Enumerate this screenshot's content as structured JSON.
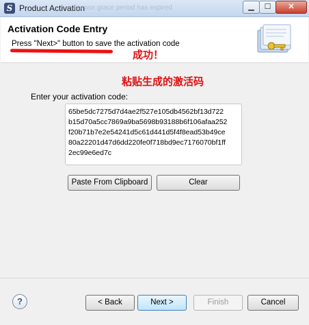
{
  "window": {
    "title": "Product Activation",
    "ghost_title": "license grace period has expired",
    "icon": "app-logo-icon",
    "controls": [
      "minimize-icon",
      "maximize-icon",
      "close-icon"
    ]
  },
  "header": {
    "title": "Activation Code Entry",
    "description": "Press \"Next>\" button to save the activation code",
    "annotation_success": "成功！",
    "art": "folder-key-icon"
  },
  "main": {
    "annotation_paste": "粘贴生成的激活码",
    "code_label": "Enter your activation code:",
    "code_value": "65be5dc7275d7d4ae2f527e105db4562bf13d722\nb15d70a5cc7869a9ba5698b93188b6f106afaa252\nf20b71b7e2e54241d5c61d441d5f4f8ead53b49ce\n80a22201d47d6dd220fe0f718bd9ec7176070bf1ff\n2ec99e6ed7c",
    "paste_label": "Paste From Clipboard",
    "clear_label": "Clear"
  },
  "footer": {
    "help": "?",
    "back_label": "< Back",
    "next_label": "Next >",
    "finish_label": "Finish",
    "cancel_label": "Cancel"
  },
  "colors": {
    "annotation": "#e01010",
    "accent": "#3c7fb1"
  }
}
